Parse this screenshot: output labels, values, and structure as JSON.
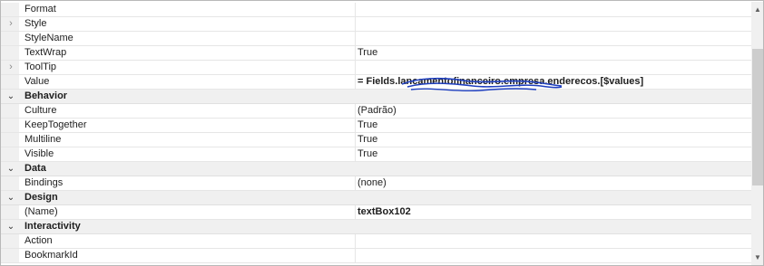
{
  "rows": [
    {
      "type": "prop",
      "name": "Format",
      "value": "",
      "expander": ""
    },
    {
      "type": "prop",
      "name": "Style",
      "value": "",
      "expander": "›"
    },
    {
      "type": "prop",
      "name": "StyleName",
      "value": "",
      "expander": ""
    },
    {
      "type": "prop",
      "name": "TextWrap",
      "value": "True",
      "expander": ""
    },
    {
      "type": "prop",
      "name": "ToolTip",
      "value": "",
      "expander": "›"
    },
    {
      "type": "prop",
      "name": "Value",
      "value": "= Fields.lancamentofinanceiro.empresa.enderecos.[$values]",
      "expander": "",
      "bold": true
    },
    {
      "type": "cat",
      "name": "Behavior",
      "expander": "⌄"
    },
    {
      "type": "prop",
      "name": "Culture",
      "value": "(Padrão)",
      "expander": ""
    },
    {
      "type": "prop",
      "name": "KeepTogether",
      "value": "True",
      "expander": ""
    },
    {
      "type": "prop",
      "name": "Multiline",
      "value": "True",
      "expander": ""
    },
    {
      "type": "prop",
      "name": "Visible",
      "value": "True",
      "expander": ""
    },
    {
      "type": "cat",
      "name": "Data",
      "expander": "⌄"
    },
    {
      "type": "prop",
      "name": "Bindings",
      "value": "(none)",
      "expander": ""
    },
    {
      "type": "cat",
      "name": "Design",
      "expander": "⌄"
    },
    {
      "type": "prop",
      "name": "(Name)",
      "value": "textBox102",
      "expander": "",
      "bold": true
    },
    {
      "type": "cat",
      "name": "Interactivity",
      "expander": "⌄"
    },
    {
      "type": "prop",
      "name": "Action",
      "value": "",
      "expander": ""
    },
    {
      "type": "prop",
      "name": "BookmarkId",
      "value": "",
      "expander": ""
    }
  ],
  "scrollbar": {
    "up_arrow": "▲",
    "down_arrow": "▼"
  },
  "colors": {
    "category_bg": "#f0f0f0",
    "scribble": "#1f3fbf"
  }
}
